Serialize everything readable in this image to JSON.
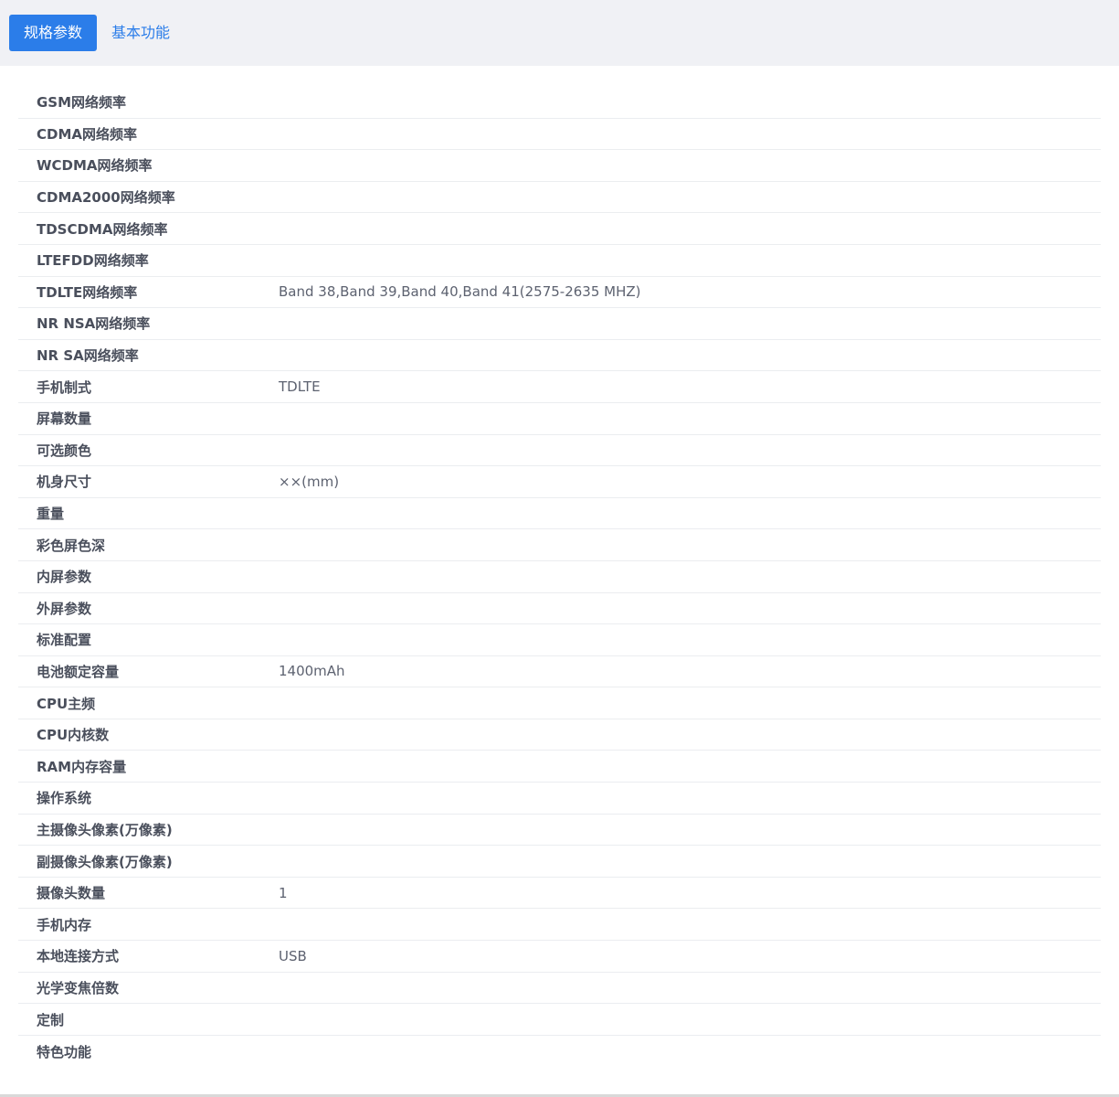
{
  "tabs": [
    {
      "label": "规格参数",
      "active": true
    },
    {
      "label": "基本功能",
      "active": false
    }
  ],
  "specs": [
    {
      "label": "GSM网络频率",
      "value": ""
    },
    {
      "label": "CDMA网络频率",
      "value": ""
    },
    {
      "label": "WCDMA网络频率",
      "value": ""
    },
    {
      "label": "CDMA2000网络频率",
      "value": ""
    },
    {
      "label": "TDSCDMA网络频率",
      "value": ""
    },
    {
      "label": "LTEFDD网络频率",
      "value": ""
    },
    {
      "label": "TDLTE网络频率",
      "value": "Band 38,Band 39,Band 40,Band 41(2575-2635 MHZ)"
    },
    {
      "label": "NR NSA网络频率",
      "value": ""
    },
    {
      "label": "NR SA网络频率",
      "value": ""
    },
    {
      "label": "手机制式",
      "value": "TDLTE"
    },
    {
      "label": "屏幕数量",
      "value": ""
    },
    {
      "label": "可选颜色",
      "value": ""
    },
    {
      "label": "机身尺寸",
      "value": "××(mm)"
    },
    {
      "label": "重量",
      "value": ""
    },
    {
      "label": "彩色屏色深",
      "value": ""
    },
    {
      "label": "内屏参数",
      "value": ""
    },
    {
      "label": "外屏参数",
      "value": ""
    },
    {
      "label": "标准配置",
      "value": ""
    },
    {
      "label": "电池额定容量",
      "value": "1400mAh"
    },
    {
      "label": "CPU主频",
      "value": ""
    },
    {
      "label": "CPU内核数",
      "value": ""
    },
    {
      "label": "RAM内存容量",
      "value": ""
    },
    {
      "label": "操作系统",
      "value": ""
    },
    {
      "label": "主摄像头像素(万像素)",
      "value": ""
    },
    {
      "label": "副摄像头像素(万像素)",
      "value": ""
    },
    {
      "label": "摄像头数量",
      "value": "1"
    },
    {
      "label": "手机内存",
      "value": ""
    },
    {
      "label": "本地连接方式",
      "value": "USB"
    },
    {
      "label": "光学变焦倍数",
      "value": ""
    },
    {
      "label": "定制",
      "value": ""
    },
    {
      "label": "特色功能",
      "value": ""
    }
  ],
  "colors": {
    "accent": "#2b7de9",
    "tabbar_bg": "#f0f1f5",
    "divider": "#ebedf0"
  }
}
